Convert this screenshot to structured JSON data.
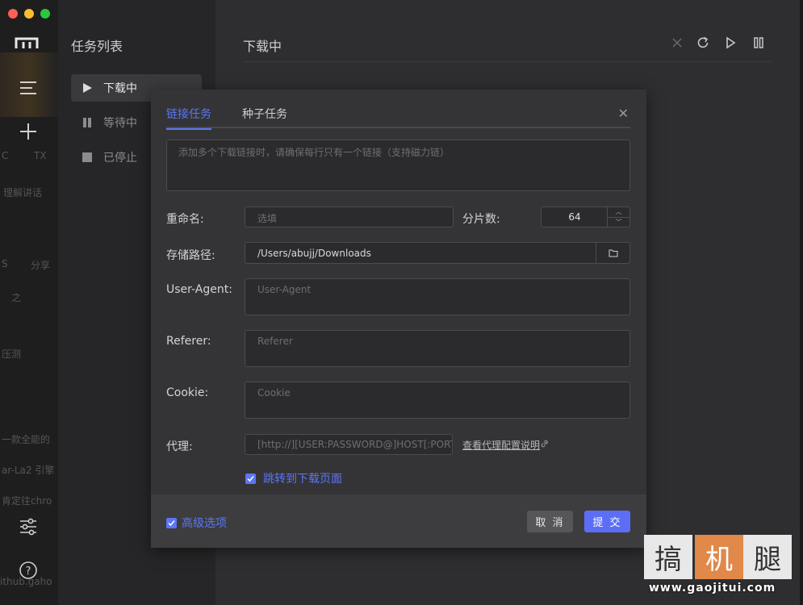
{
  "window": {
    "traffic_lights": [
      "#fe5f57",
      "#febc2e",
      "#28c840"
    ]
  },
  "sidebar_bleed": [
    "C",
    "TX",
    "理解讲话",
    "S",
    "分享",
    "之",
    "压测",
    "一款全能的",
    "ar-La2 引擎",
    "肯定往chro",
    "ithub.gaho"
  ],
  "tasklist": {
    "title": "任务列表",
    "items": [
      {
        "label": "下载中",
        "icon": "play-icon",
        "active": true
      },
      {
        "label": "等待中",
        "icon": "pause-icon",
        "active": false
      },
      {
        "label": "已停止",
        "icon": "stop-icon",
        "active": false
      }
    ]
  },
  "main": {
    "title": "下载中",
    "toolbar": [
      "close-icon",
      "refresh-icon",
      "play-icon",
      "pause-icon"
    ]
  },
  "modal": {
    "tabs": [
      "链接任务",
      "种子任务"
    ],
    "links_placeholder": "添加多个下载链接时，请确保每行只有一个链接（支持磁力链）",
    "rename_label": "重命名:",
    "rename_placeholder": "选填",
    "split_label": "分片数:",
    "split_value": "64",
    "path_label": "存储路径:",
    "path_value": "/Users/abujj/Downloads",
    "ua_label": "User-Agent:",
    "ua_placeholder": "User-Agent",
    "referer_label": "Referer:",
    "referer_placeholder": "Referer",
    "cookie_label": "Cookie:",
    "cookie_placeholder": "Cookie",
    "proxy_label": "代理:",
    "proxy_placeholder": "[http://][USER:PASSWORD@]HOST[:PORT]",
    "proxy_help": "查看代理配置说明",
    "jump_label": "跳转到下载页面",
    "advanced_label": "高级选项",
    "cancel_label": "取 消",
    "submit_label": "提 交"
  },
  "watermark": {
    "chars": [
      "搞",
      "机",
      "腿"
    ],
    "url": "www.gaojitui.com"
  },
  "colors": {
    "accent": "#5b76f7",
    "submit": "#5b6ef5"
  }
}
